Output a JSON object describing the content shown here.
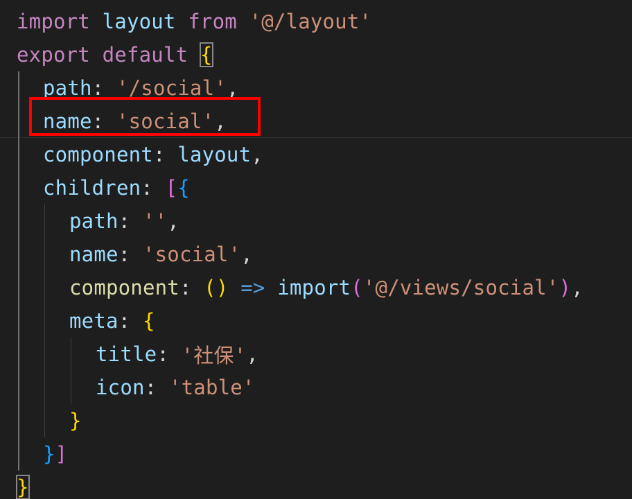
{
  "editor": {
    "lines": [
      [
        {
          "t": "import ",
          "c": "kw"
        },
        {
          "t": "layout ",
          "c": "var"
        },
        {
          "t": "from ",
          "c": "kw"
        },
        {
          "t": "'@/layout'",
          "c": "str"
        }
      ],
      [
        {
          "t": "export ",
          "c": "kw"
        },
        {
          "t": "default ",
          "c": "kw"
        },
        {
          "t": "{",
          "c": "br1",
          "m": 1
        }
      ],
      [
        {
          "t": "path",
          "c": "var"
        },
        {
          "t": ": ",
          "c": "pun"
        },
        {
          "t": "'/social'",
          "c": "str"
        },
        {
          "t": ",",
          "c": "pun"
        }
      ],
      [
        {
          "t": "name",
          "c": "var"
        },
        {
          "t": ": ",
          "c": "pun"
        },
        {
          "t": "'social'",
          "c": "str"
        },
        {
          "t": ",",
          "c": "pun"
        }
      ],
      [
        {
          "t": "component",
          "c": "var"
        },
        {
          "t": ": ",
          "c": "pun"
        },
        {
          "t": "layout",
          "c": "var"
        },
        {
          "t": ",",
          "c": "pun"
        }
      ],
      [
        {
          "t": "children",
          "c": "var"
        },
        {
          "t": ": ",
          "c": "pun"
        },
        {
          "t": "[",
          "c": "br2"
        },
        {
          "t": "{",
          "c": "br3"
        }
      ],
      [
        {
          "t": "path",
          "c": "var"
        },
        {
          "t": ": ",
          "c": "pun"
        },
        {
          "t": "''",
          "c": "str"
        },
        {
          "t": ",",
          "c": "pun"
        }
      ],
      [
        {
          "t": "name",
          "c": "var"
        },
        {
          "t": ": ",
          "c": "pun"
        },
        {
          "t": "'social'",
          "c": "str"
        },
        {
          "t": ",",
          "c": "pun"
        }
      ],
      [
        {
          "t": "component",
          "c": "fn"
        },
        {
          "t": ": ",
          "c": "pun"
        },
        {
          "t": "() ",
          "c": "br1"
        },
        {
          "t": "=> ",
          "c": "op"
        },
        {
          "t": "import",
          "c": "var"
        },
        {
          "t": "(",
          "c": "br2"
        },
        {
          "t": "'@/views/social'",
          "c": "str"
        },
        {
          "t": ")",
          "c": "br2"
        },
        {
          "t": ",",
          "c": "pun"
        }
      ],
      [
        {
          "t": "meta",
          "c": "var"
        },
        {
          "t": ": ",
          "c": "pun"
        },
        {
          "t": "{",
          "c": "br1"
        }
      ],
      [
        {
          "t": "title",
          "c": "var"
        },
        {
          "t": ": ",
          "c": "pun"
        },
        {
          "t": "'社保'",
          "c": "str"
        },
        {
          "t": ",",
          "c": "pun"
        }
      ],
      [
        {
          "t": "icon",
          "c": "var"
        },
        {
          "t": ": ",
          "c": "pun"
        },
        {
          "t": "'table'",
          "c": "str"
        }
      ],
      [
        {
          "t": "}",
          "c": "br1"
        }
      ],
      [
        {
          "t": "}",
          "c": "br3"
        },
        {
          "t": "]",
          "c": "br2"
        }
      ],
      [
        {
          "t": "}",
          "c": "br1",
          "m": 1
        }
      ]
    ],
    "indents": [
      0,
      0,
      1,
      1,
      1,
      1,
      2,
      2,
      2,
      2,
      3,
      3,
      2,
      1,
      0
    ]
  },
  "colors": {
    "background": "#1e1e1e",
    "keyword": "#c586c0",
    "variable": "#9cdcfe",
    "function": "#dcdcaa",
    "string": "#ce9178",
    "bracket_gold": "#ffd700",
    "bracket_orchid": "#da70d6",
    "bracket_blue": "#179fff",
    "highlight_box": "#ff0000"
  }
}
